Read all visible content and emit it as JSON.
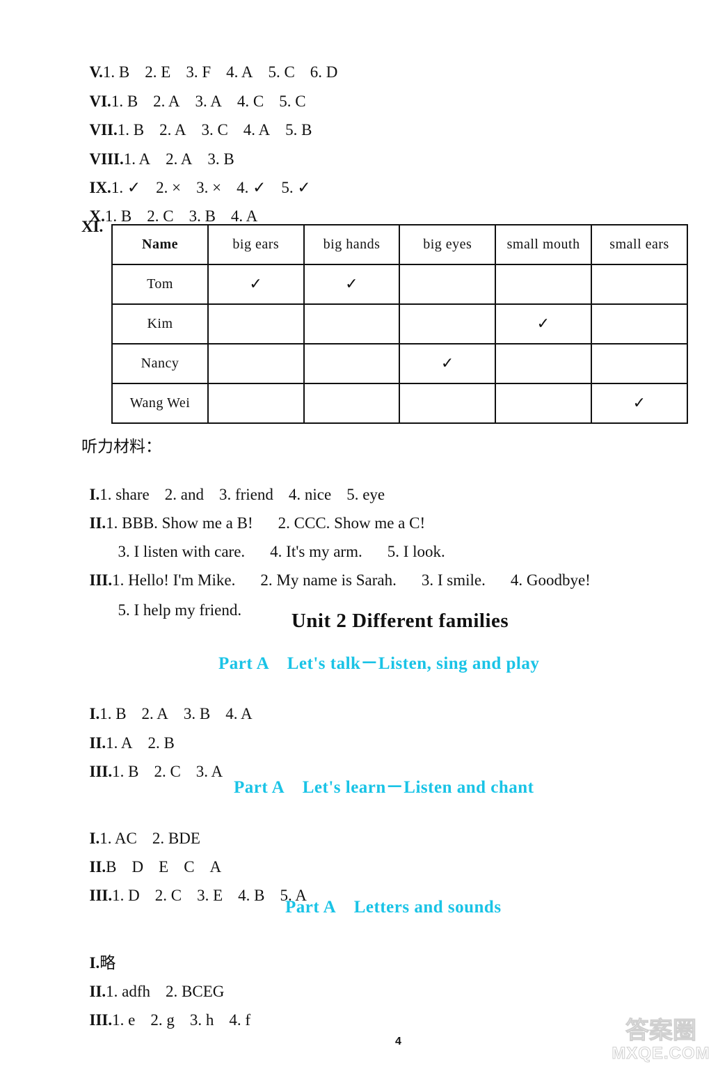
{
  "answers_top": [
    {
      "num": "V.",
      "items": [
        "1. B",
        "2. E",
        "3. F",
        "4. A",
        "5. C",
        "6. D"
      ]
    },
    {
      "num": "VI.",
      "items": [
        "1. B",
        "2. A",
        "3. A",
        "4. C",
        "5. C"
      ]
    },
    {
      "num": "VII.",
      "items": [
        "1. B",
        "2. A",
        "3. C",
        "4. A",
        "5. B"
      ]
    },
    {
      "num": "VIII.",
      "items": [
        "1. A",
        "2. A",
        "3. B"
      ]
    },
    {
      "num": "IX.",
      "items": [
        "1. ✓",
        "2. ×",
        "3. ×",
        "4. ✓",
        "5. ✓"
      ]
    },
    {
      "num": "X.",
      "items": [
        "1. B",
        "2. C",
        "3. B",
        "4. A"
      ]
    }
  ],
  "table_section": {
    "num": "XI.",
    "headers": [
      "Name",
      "big ears",
      "big hands",
      "big eyes",
      "small mouth",
      "small ears"
    ],
    "rows": [
      {
        "name": "Tom",
        "cells": [
          "✓",
          "✓",
          "",
          "",
          ""
        ]
      },
      {
        "name": "Kim",
        "cells": [
          "",
          "",
          "",
          "✓",
          ""
        ]
      },
      {
        "name": "Nancy",
        "cells": [
          "",
          "",
          "✓",
          "",
          ""
        ]
      },
      {
        "name": "Wang Wei",
        "cells": [
          "",
          "",
          "",
          "",
          "✓"
        ]
      }
    ]
  },
  "listening": {
    "heading": "听力材料：",
    "lines": [
      {
        "num": "I.",
        "items": [
          "1. share",
          "2. and",
          "3. friend",
          "4. nice",
          "5. eye"
        ]
      },
      {
        "num": "II.",
        "items": [
          "1. BBB. Show me a B!",
          "2. CCC. Show me a C!"
        ]
      },
      {
        "num": "",
        "items": [
          "3. I listen with care.",
          "4. It's my arm.",
          "5. I look."
        ]
      },
      {
        "num": "III.",
        "items": [
          "1. Hello! I'm Mike.",
          "2. My name is Sarah.",
          "3. I smile.",
          "4. Goodbye!"
        ]
      },
      {
        "num": "",
        "items": [
          "5. I help my friend."
        ]
      }
    ]
  },
  "unit": {
    "title": "Unit 2    Different families",
    "parts": [
      {
        "title": "Part A    Let's talk－Listen, sing and play",
        "lines": [
          {
            "num": "I.",
            "items": [
              "1. B",
              "2. A",
              "3. B",
              "4. A"
            ]
          },
          {
            "num": "II.",
            "items": [
              "1. A",
              "2. B"
            ]
          },
          {
            "num": "III.",
            "items": [
              "1. B",
              "2. C",
              "3. A"
            ]
          }
        ]
      },
      {
        "title": "Part A    Let's learn－Listen and chant",
        "lines": [
          {
            "num": "I.",
            "items": [
              "1. AC",
              "2. BDE"
            ]
          },
          {
            "num": "II.",
            "items": [
              "B",
              "D",
              "E",
              "C",
              "A"
            ]
          },
          {
            "num": "III.",
            "items": [
              "1. D",
              "2. C",
              "3. E",
              "4. B",
              "5. A"
            ]
          }
        ]
      },
      {
        "title": "Part A    Letters and sounds",
        "lines": [
          {
            "num": "I.",
            "items": [
              "略"
            ]
          },
          {
            "num": "II.",
            "items": [
              "1. adfh",
              "2. BCEG"
            ]
          },
          {
            "num": "III.",
            "items": [
              "1. e",
              "2. g",
              "3. h",
              "4. f"
            ]
          }
        ]
      }
    ]
  },
  "page_number": "4",
  "watermark": {
    "top": "答案圈",
    "bottom": "MXQE.COM"
  },
  "colors": {
    "part_title": "#19c3e6",
    "text": "#111111"
  }
}
